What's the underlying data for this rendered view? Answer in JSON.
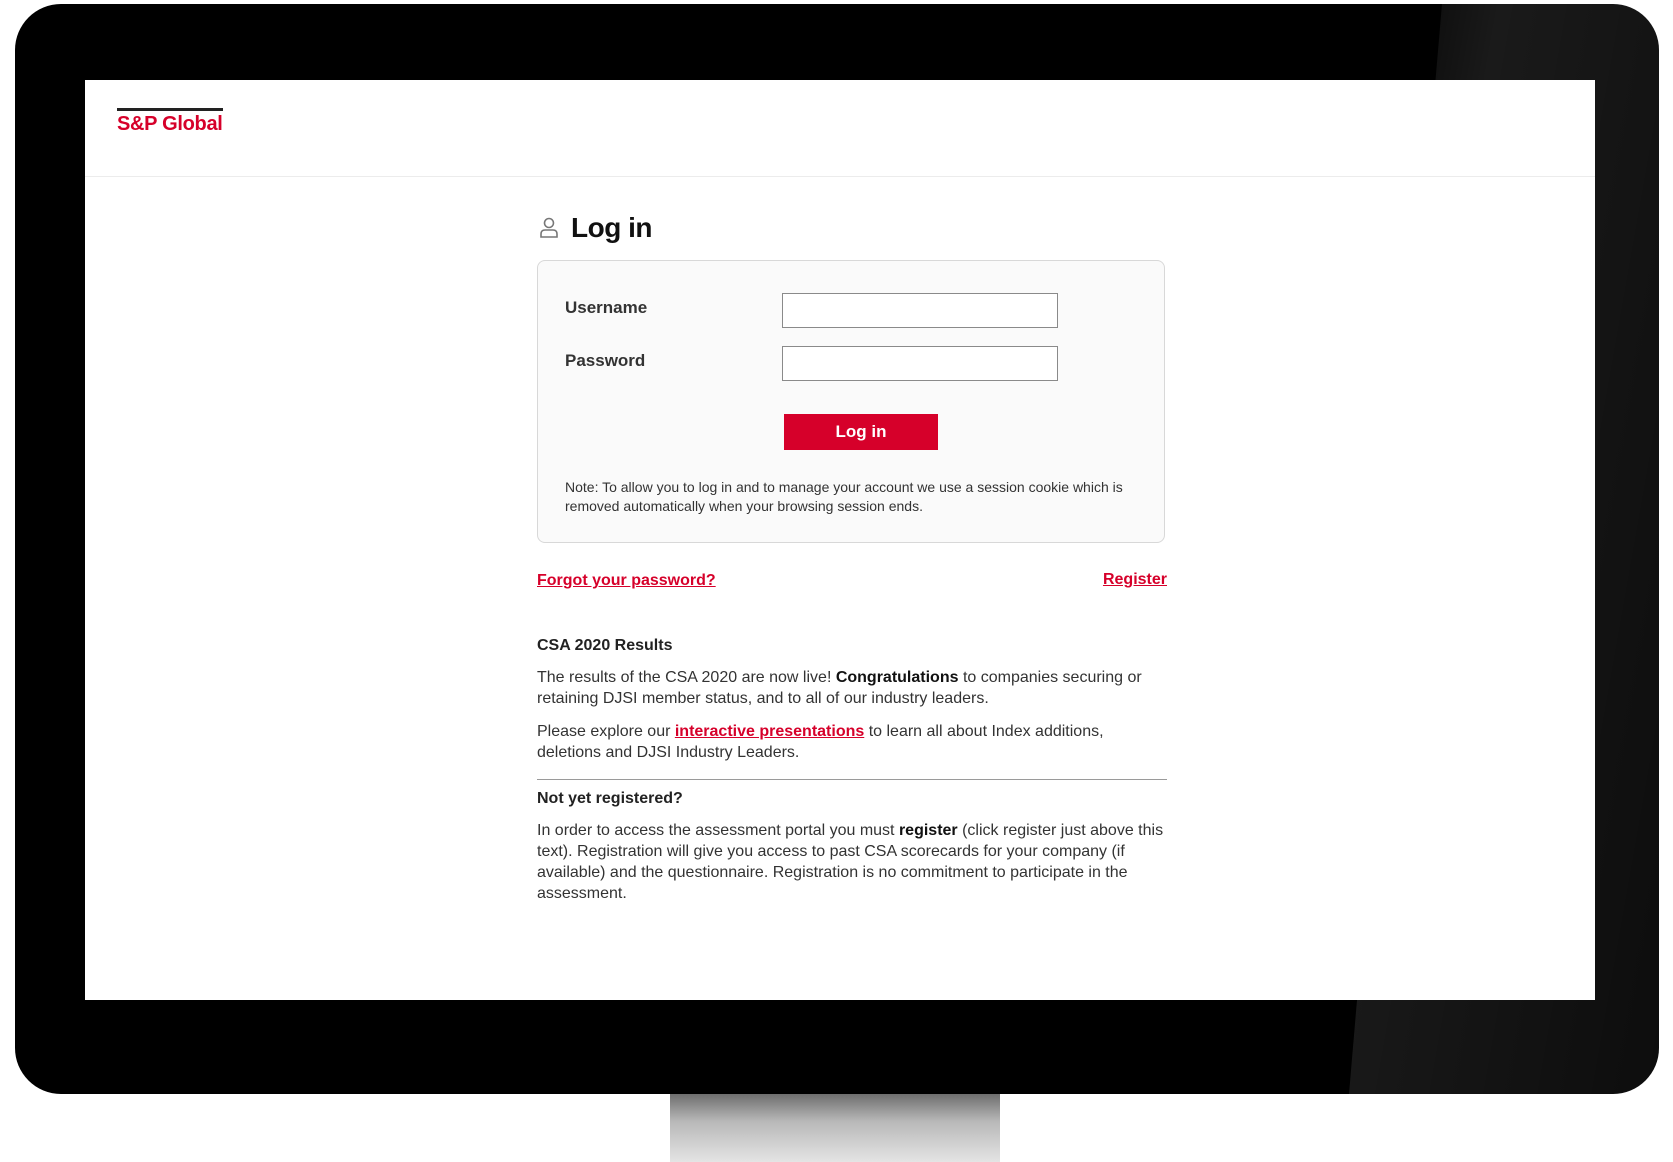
{
  "brand": {
    "logo_text": "S&P Global",
    "accent_color": "#d6002a"
  },
  "login": {
    "title": "Log in",
    "title_icon": "user-icon",
    "username_label": "Username",
    "username_value": "",
    "password_label": "Password",
    "password_value": "",
    "submit_label": "Log in",
    "note": "Note: To allow you to log in and to manage your account we use a session cookie which is removed automatically when your browsing session ends."
  },
  "links": {
    "forgot_password": "Forgot your password?",
    "register": "Register"
  },
  "csa": {
    "heading": "CSA 2020 Results",
    "p1_start": "The results of the CSA 2020 are now live! ",
    "p1_bold": "Congratulations",
    "p1_end": " to companies securing or retaining DJSI member status, and to all of our industry leaders.",
    "p2_start": "Please explore our ",
    "p2_link": "interactive presentations",
    "p2_end": " to learn all about Index additions, deletions and DJSI Industry Leaders."
  },
  "not_registered": {
    "heading": "Not yet registered?",
    "p_start": "In order to access the assessment portal you must ",
    "p_bold": "register",
    "p_end": " (click register just above this text). Registration will give you access to past CSA scorecards for your company (if available) and the questionnaire. Registration is no commitment to participate in the assessment."
  }
}
